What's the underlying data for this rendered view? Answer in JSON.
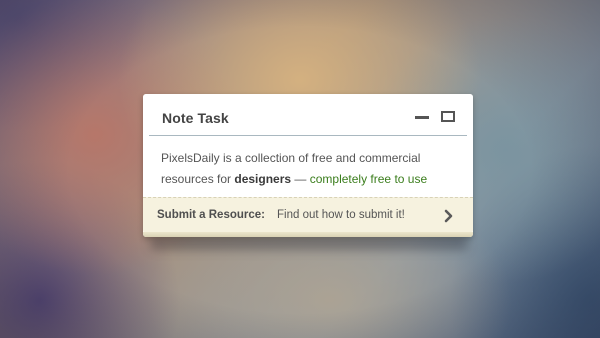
{
  "window": {
    "title": "Note Task",
    "minimize_icon": "minimize-icon",
    "maximize_icon": "maximize-icon"
  },
  "content": {
    "text_part1": "PixelsDaily is a collection of free and commercial resources for ",
    "text_bold": "designers",
    "text_dash": " — ",
    "text_green": "completely free to use"
  },
  "footer": {
    "label": "Submit a Resource:",
    "link_text": "Find out how to submit it!",
    "chevron_icon": "chevron-right-icon"
  },
  "colors": {
    "green_text": "#3a7d1c",
    "footer_bg": "#f6f2df",
    "title_text": "#444444"
  }
}
